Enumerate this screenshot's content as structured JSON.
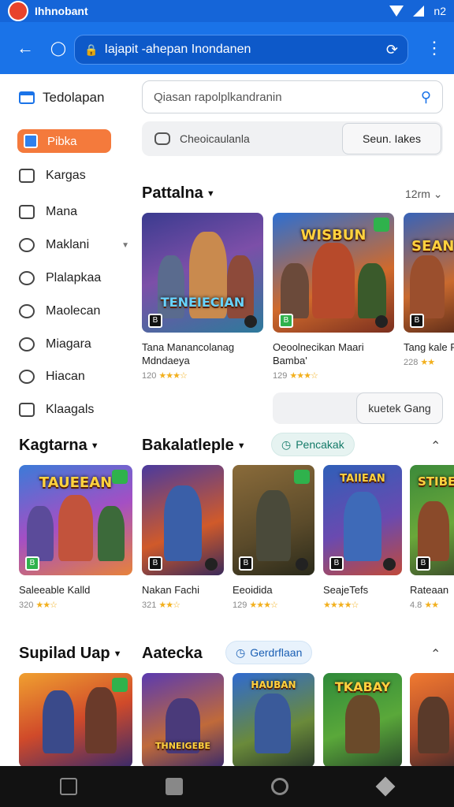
{
  "status": {
    "title": "Ihhnobant",
    "right_text": "n2"
  },
  "address_bar": {
    "text": "Iajapit -ahepan Inondanen"
  },
  "sidebar": {
    "heading": "Tedolapan",
    "active": "Pibka",
    "items": [
      "Kargas",
      "Mana",
      "Maklani",
      "Plalapkaa",
      "Maolecan",
      "Miagara",
      "Hiacan",
      "Klaagals"
    ]
  },
  "search": {
    "placeholder": "Qiasan rapolplkandranin"
  },
  "filter": {
    "label": "Cheoicaulanla",
    "button": "Seun. Iakes"
  },
  "section1": {
    "title": "Pattalna",
    "right": "12rm",
    "cards": [
      {
        "art": "TENEIECIAN",
        "title": "Tana Manancolanag Mdndaeya",
        "rating": "120",
        "stars": "★★★☆"
      },
      {
        "art": "WISBUN",
        "title": "Oeoolnecikan Maari Bamba'",
        "rating": "129",
        "stars": "★★★☆"
      },
      {
        "art": "SEAN",
        "title": "Tang kale Ramsa",
        "rating": "228",
        "stars": "★★"
      }
    ],
    "install_button": "kuetek Gang"
  },
  "section2": {
    "left_title": "Kagtarna",
    "title": "Bakalatleple",
    "pill": "Pencakak",
    "cards": [
      {
        "art": "TAUEEAN",
        "title": "Saleeable Kalld",
        "rating": "320",
        "stars": "★★☆"
      },
      {
        "art": "",
        "title": "Nakan Fachi",
        "rating": "321",
        "stars": "★★☆"
      },
      {
        "art": "",
        "title": "Eeoidida",
        "rating": "129",
        "stars": "★★★☆"
      },
      {
        "art": "TAIIEAN",
        "title": "SeajeTefs",
        "rating": "",
        "stars": "★★★★☆"
      },
      {
        "art": "STIBE",
        "title": "Rateaan",
        "rating": "4.8",
        "stars": "★★"
      }
    ]
  },
  "section3": {
    "left_title": "Supilad Uap",
    "title": "Aatecka",
    "pill": "Gerdrflaan",
    "cards": [
      {
        "art": ""
      },
      {
        "art": "THNEIGEBE"
      },
      {
        "art": "HAUBAN"
      },
      {
        "art": "TKABAY"
      },
      {
        "art": ""
      }
    ]
  },
  "colors": {
    "primary": "#1a73e8",
    "accent": "#f47a3c",
    "star": "#f2b01e"
  }
}
